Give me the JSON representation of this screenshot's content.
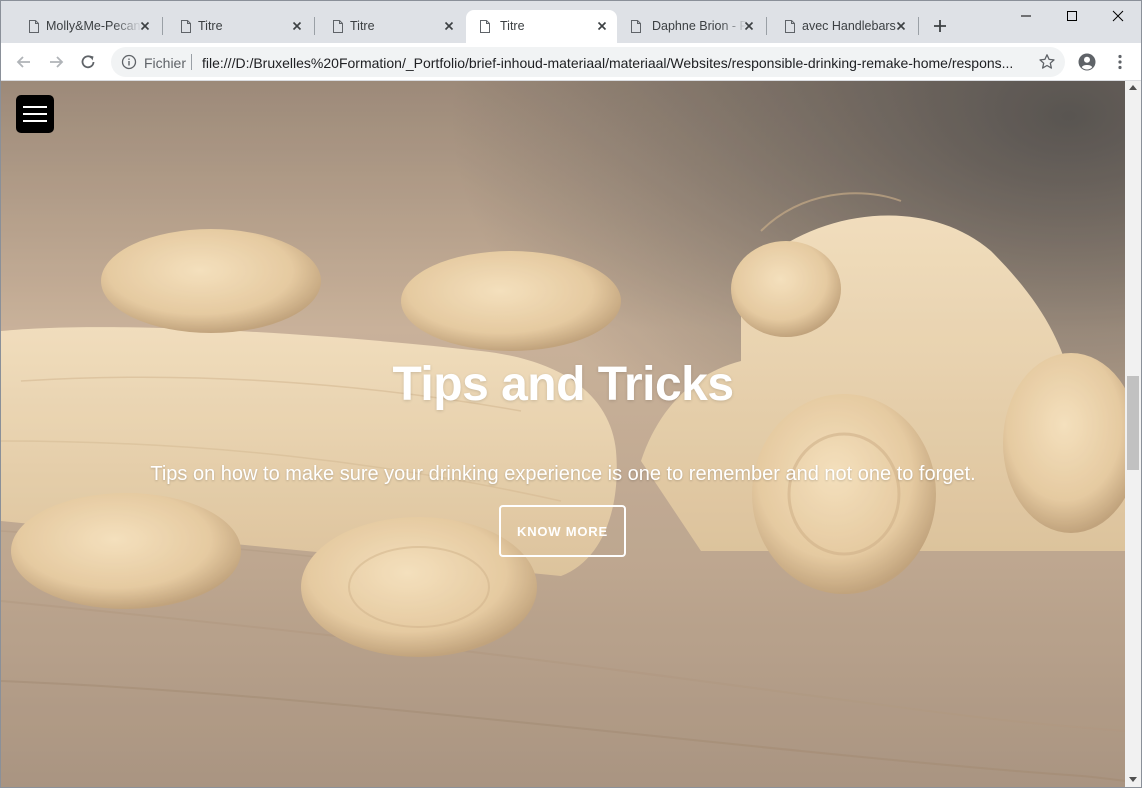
{
  "browser": {
    "tabs": [
      {
        "title": "Molly&Me-Pecan",
        "active": false
      },
      {
        "title": "Titre",
        "active": false
      },
      {
        "title": "Titre",
        "active": false
      },
      {
        "title": "Titre",
        "active": true
      },
      {
        "title": "Daphne Brion - P",
        "active": false
      },
      {
        "title": "avec Handlebars",
        "active": false
      }
    ],
    "omnibox": {
      "scheme_label": "Fichier",
      "url": "file:///D:/Bruxelles%20Formation/_Portfolio/brief-inhoud-materiaal/materiaal/Websites/responsible-drinking-remake-home/respons..."
    }
  },
  "page": {
    "hero": {
      "title": "Tips and Tricks",
      "subtitle": "Tips on how to make sure your drinking experience is one to remember and not one to forget.",
      "button_label": "KNOW MORE"
    }
  },
  "colors": {
    "tab_strip": "#dee1e6",
    "hamburger_bg": "#000000",
    "hero_text": "#ffffff",
    "wood_light": "#e8cfa5",
    "wood_floor": "#a48c74"
  }
}
